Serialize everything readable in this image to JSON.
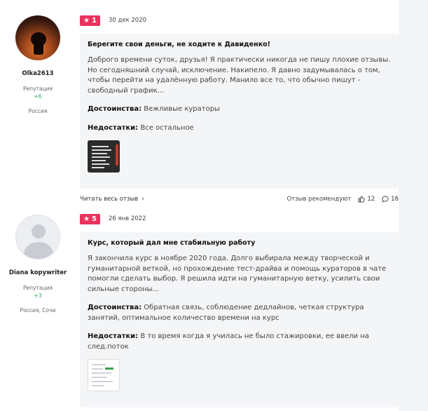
{
  "reviews": [
    {
      "user": {
        "name": "Olka2613",
        "reputation_label": "Репутация",
        "reputation": "+6",
        "location": "Россия"
      },
      "rating": "1",
      "date": "30 дек 2020",
      "title": "Берегите свои деньги, не ходите к Давиденко!",
      "text": "Доброго времени суток, друзья! Я практически никогда не пишу плохие отзывы. Но сегодняшний случай, исключение. Накипело. Я давно задумывалась о том, чтобы перейти на удалённую работу. Манило все то, что обычно пишут - свободный график...",
      "pros_label": "Достоинства:",
      "pros": "Вежливые кураторы",
      "cons_label": "Недостатки:",
      "cons": "Все остальное",
      "read_all": "Читать весь отзыв",
      "recommend": "Отзыв рекомендуют",
      "likes": "12",
      "comments": "16"
    },
    {
      "user": {
        "name": "Diana kopywriter",
        "reputation_label": "Репутация",
        "reputation": "+3",
        "location": "Россия, Сочи"
      },
      "rating": "5",
      "date": "26 янв 2022",
      "title": "Курс, который дал мне стабильную работу",
      "text": "Я закончила курс в ноябре 2020 года. Долго выбирала между творческой и гуманитарной веткой, но прохождение тест-драйва и помощь кураторов в чате помогли сделать выбор. Я решила идти на гуманитарную ветку, усилить свои сильные стороны...",
      "pros_label": "Достоинства:",
      "pros": "Обратная связь, соблюдение дедлайнов, четкая структура занятий, оптимальное количество времени на курс",
      "cons_label": "Недостатки:",
      "cons": "В то время когда я училась не было стажировки, ее ввели на след.поток"
    }
  ],
  "colors": {
    "rating_badge": "#e8335e",
    "reputation": "#2fa84f",
    "card_bg": "#f4f5f7"
  }
}
